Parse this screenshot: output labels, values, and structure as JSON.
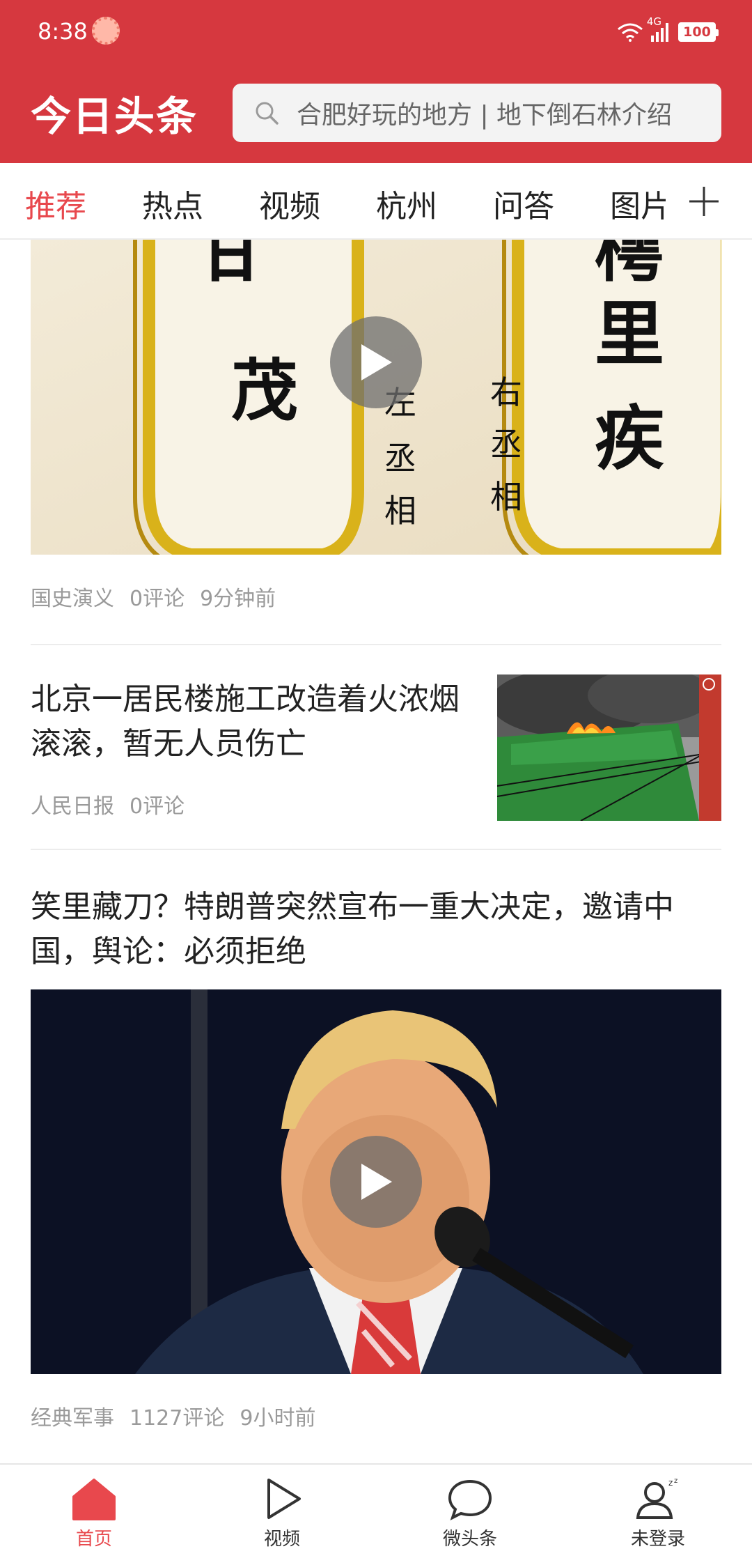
{
  "status_bar": {
    "time": "8:38",
    "network": "4G",
    "battery": "100"
  },
  "header": {
    "logo": "今日头条",
    "search_placeholder": "合肥好玩的地方 | 地下倒石林介绍"
  },
  "tabs": [
    {
      "label": "推荐"
    },
    {
      "label": "热点"
    },
    {
      "label": "视频"
    },
    {
      "label": "杭州"
    },
    {
      "label": "问答"
    },
    {
      "label": "图片"
    }
  ],
  "feed": {
    "item1": {
      "image_text": [
        "甘",
        "茂",
        "左",
        "丞",
        "相",
        "樗",
        "里",
        "疾",
        "右",
        "丞",
        "相"
      ],
      "source": "国史演义",
      "comments": "0评论",
      "time": "9分钟前"
    },
    "item2": {
      "title": "北京一居民楼施工改造着火浓烟滚滚，暂无人员伤亡",
      "source": "人民日报",
      "comments": "0评论"
    },
    "item3": {
      "title": "笑里藏刀？特朗普突然宣布一重大决定，邀请中国，舆论：必须拒绝",
      "source": "经典军事",
      "comments": "1127评论",
      "time": "9小时前"
    }
  },
  "bottom_nav": [
    {
      "label": "首页"
    },
    {
      "label": "视频"
    },
    {
      "label": "微头条"
    },
    {
      "label": "未登录"
    }
  ],
  "colors": {
    "brand_red": "#d6383f",
    "active_red": "#e8484d"
  }
}
